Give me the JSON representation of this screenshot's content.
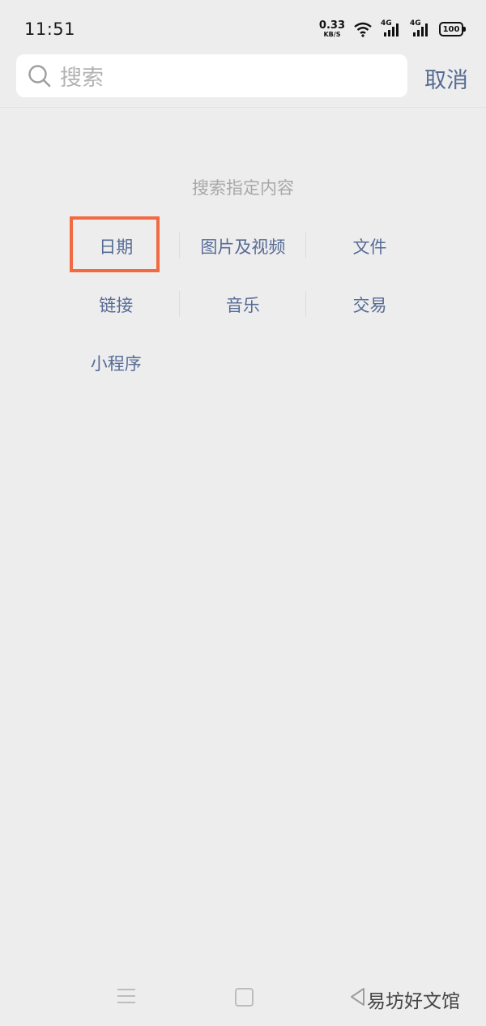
{
  "status_bar": {
    "time": "11:51",
    "net_speed_value": "0.33",
    "net_speed_unit": "KB/S",
    "sim1_label": "4G",
    "sim2_label": "4G",
    "battery": "100"
  },
  "search": {
    "placeholder": "搜索",
    "cancel_label": "取消"
  },
  "content": {
    "title": "搜索指定内容",
    "categories": [
      [
        "日期",
        "图片及视频",
        "文件"
      ],
      [
        "链接",
        "音乐",
        "交易"
      ],
      [
        "小程序"
      ]
    ]
  },
  "watermark": "易坊好文馆",
  "colors": {
    "link": "#576b95",
    "highlight": "#f26a43",
    "background": "#ededed"
  }
}
